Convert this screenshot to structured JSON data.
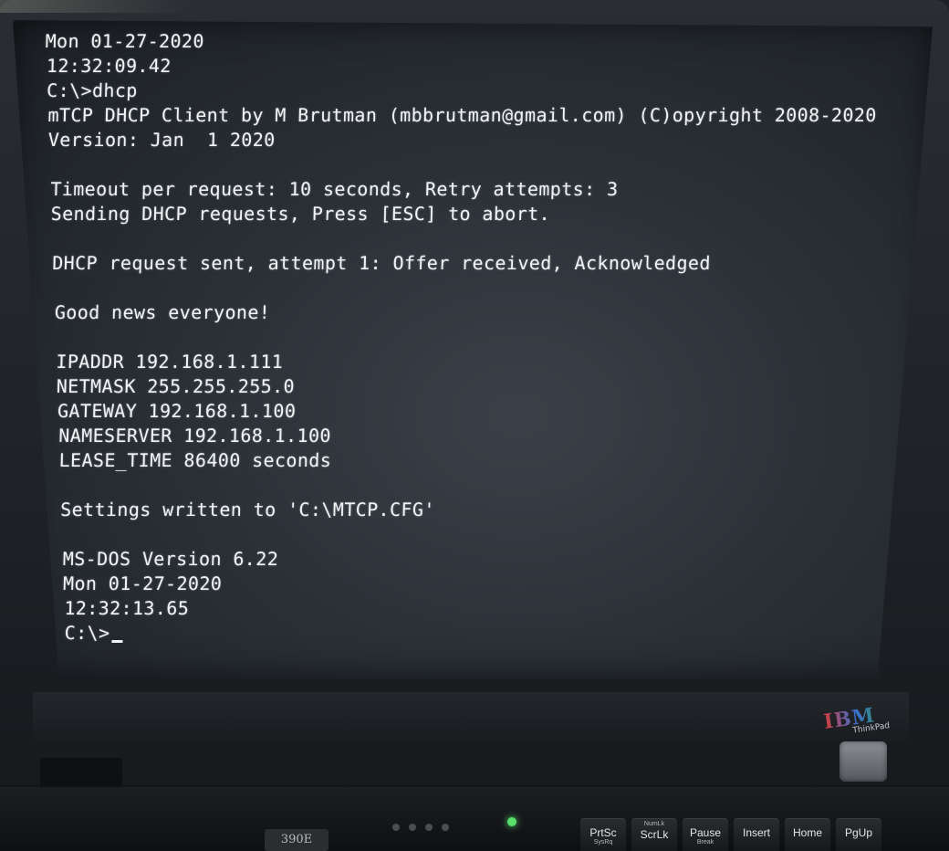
{
  "terminal": {
    "lines": [
      "Mon 01-27-2020",
      "12:32:09.42",
      "C:\\>dhcp",
      "mTCP DHCP Client by M Brutman (mbbrutman@gmail.com) (C)opyright 2008-2020",
      "Version: Jan  1 2020",
      "",
      "Timeout per request: 10 seconds, Retry attempts: 3",
      "Sending DHCP requests, Press [ESC] to abort.",
      "",
      "DHCP request sent, attempt 1: Offer received, Acknowledged",
      "",
      "Good news everyone!",
      "",
      "IPADDR 192.168.1.111",
      "NETMASK 255.255.255.0",
      "GATEWAY 192.168.1.100",
      "NAMESERVER 192.168.1.100",
      "LEASE_TIME 86400 seconds",
      "",
      "Settings written to 'C:\\MTCP.CFG'",
      "",
      "MS-DOS Version 6.22",
      "Mon 01-27-2020",
      "12:32:13.65",
      "C:\\>"
    ]
  },
  "laptop": {
    "brand": "IBM",
    "product": "ThinkPad",
    "model": "390E",
    "keys": [
      {
        "main": "PrtSc",
        "sub": "SysRq",
        "top": ""
      },
      {
        "main": "ScrLk",
        "sub": "",
        "top": "NumLk"
      },
      {
        "main": "Pause",
        "sub": "Break",
        "top": ""
      },
      {
        "main": "Insert",
        "sub": "",
        "top": ""
      },
      {
        "main": "Home",
        "sub": "",
        "top": ""
      },
      {
        "main": "PgUp",
        "sub": "",
        "top": ""
      }
    ],
    "power_led_color": "#58e06a"
  }
}
